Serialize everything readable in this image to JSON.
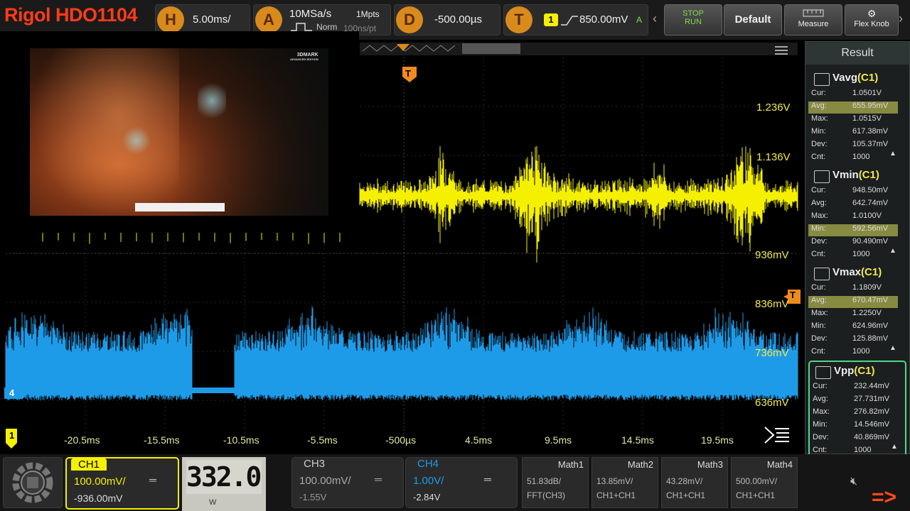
{
  "app_title": "Rigol HDO1104",
  "top": {
    "h_letter": "H",
    "h_value": "5.00ms/",
    "a_letter": "A",
    "a_rate": "10MSa/s",
    "a_depth": "1Mpts",
    "a_mode": "Norm",
    "a_pt": "100ns/pt",
    "d_letter": "D",
    "d_value": "-500.00µs",
    "t_letter": "T",
    "t_channel": "1",
    "t_value": "850.00mV",
    "t_mode": "A",
    "stop": "STOP",
    "run": "RUN",
    "default": "Default",
    "measure": "Measure",
    "flex": "Flex Knob"
  },
  "overlay": {
    "brand": "3DMARK",
    "edition": "ADVANCED EDITION"
  },
  "scale_labels": [
    "1.236V",
    "1.136V",
    "936mV",
    "836mV",
    "736mV",
    "636mV"
  ],
  "trigger_marker": "T",
  "ch4_marker": "4",
  "ch1_marker": "1",
  "time_labels": [
    "-20.5ms",
    "-15.5ms",
    "-10.5ms",
    "-5.5ms",
    "-500µs",
    "4.5ms",
    "9.5ms",
    "14.5ms",
    "19.5ms"
  ],
  "result": {
    "title": "Result",
    "measurements": [
      {
        "name": "Vavg",
        "src": "(C1)",
        "cur": "1.0501V",
        "avg": "655.95mV",
        "max": "1.0515V",
        "min": "617.38mV",
        "dev": "105.37mV",
        "cnt": "1000"
      },
      {
        "name": "Vmin",
        "src": "(C1)",
        "cur": "948.50mV",
        "avg": "642.74mV",
        "max": "1.0100V",
        "min": "592.56mV",
        "dev": "90.490mV",
        "cnt": "1000"
      },
      {
        "name": "Vmax",
        "src": "(C1)",
        "cur": "1.1809V",
        "avg": "670.47mV",
        "max": "1.2250V",
        "min": "624.96mV",
        "dev": "125.88mV",
        "cnt": "1000"
      },
      {
        "name": "Vpp",
        "src": "(C1)",
        "cur": "232.44mV",
        "avg": "27.731mV",
        "max": "276.82mV",
        "min": "14.546mV",
        "dev": "40.869mV",
        "cnt": "1000"
      }
    ],
    "labels": {
      "cur": "Cur:",
      "avg": "Avg:",
      "max": "Max:",
      "min": "Min:",
      "dev": "Dev:",
      "cnt": "Cnt:"
    }
  },
  "channels": {
    "ch1": {
      "label": "CH1",
      "scale": "100.00mV/",
      "offset": "-936.00mV"
    },
    "ch3": {
      "label": "CH3",
      "scale": "100.00mV/",
      "offset": "-1.55V"
    },
    "ch4": {
      "label": "CH4",
      "scale": "1.00V/",
      "offset": "-2.84V"
    }
  },
  "power_meter": {
    "value": "332.0",
    "unit": "W"
  },
  "math": [
    {
      "label": "Math1",
      "a": "51.83dB/",
      "b": "FFT(CH3)"
    },
    {
      "label": "Math2",
      "a": "13.85mV/",
      "b": "CH1+CH1"
    },
    {
      "label": "Math3",
      "a": "43.28mV/",
      "b": "CH1+CH1"
    },
    {
      "label": "Math4",
      "a": "500.00mV/",
      "b": "CH1+CH1"
    }
  ],
  "arrow_text": "=>",
  "colors": {
    "ch1": "#f5f000",
    "ch4": "#1e9be8",
    "accent": "#d98a1c",
    "title": "#ff3b1a"
  }
}
